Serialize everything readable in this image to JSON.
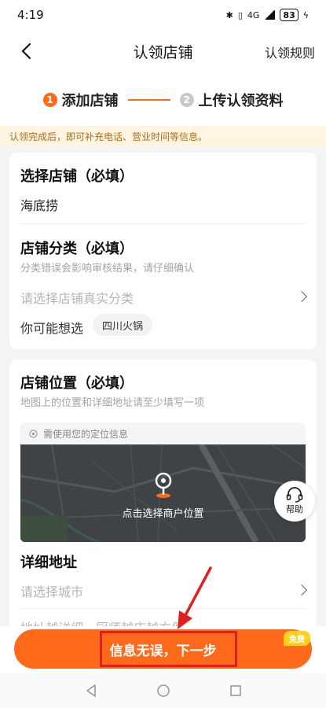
{
  "status": {
    "time": "4:19",
    "network": "4G",
    "battery": "83"
  },
  "nav": {
    "title": "认领店铺",
    "rules_label": "认领规则"
  },
  "steps": [
    {
      "num": "1",
      "label": "添加店铺"
    },
    {
      "num": "2",
      "label": "上传认领资料"
    }
  ],
  "notice": "认领完成后，即可补充电话、营业时间等信息。",
  "shop": {
    "title": "选择店铺（必填）",
    "value": "海底捞"
  },
  "category": {
    "title": "店铺分类（必填）",
    "subtitle": "分类错误会影响审核结果，请仔细确认",
    "placeholder": "请选择店铺真实分类",
    "suggest_label": "你可能想选",
    "suggestion": "四川火锅"
  },
  "location": {
    "title": "店铺位置（必填）",
    "subtitle": "地图上的位置和详细地址请至少填写一项",
    "permission_hint": "需使用您的定位信息",
    "map_label": "点击选择商户位置"
  },
  "address": {
    "title": "详细地址",
    "city_placeholder": "请选择城市",
    "detail_placeholder": "地址越详细，厨师越店越方便"
  },
  "help_label": "帮助",
  "next_button": "信息无误，下一步",
  "free_badge": "免费",
  "colors": {
    "accent": "#ff6a1a",
    "notice_bg": "#fff5e0",
    "highlight": "#e02020"
  }
}
